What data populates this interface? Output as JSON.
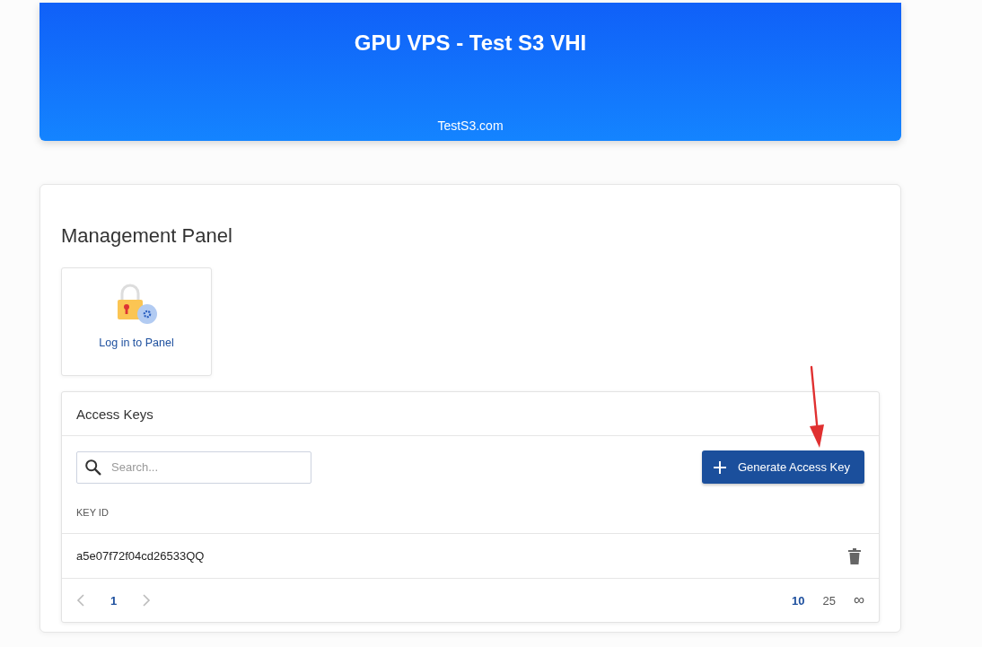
{
  "header": {
    "title": "GPU VPS - Test S3 VHI",
    "domain": "TestS3.com"
  },
  "management": {
    "title": "Management Panel",
    "tiles": [
      {
        "label": "Log in to Panel"
      }
    ]
  },
  "access_keys": {
    "title": "Access Keys",
    "search": {
      "placeholder": "Search..."
    },
    "generate_button": "Generate Access Key",
    "columns": [
      "KEY ID"
    ],
    "rows": [
      {
        "key_id": "a5e07f72f04cd26533QQ"
      }
    ],
    "pages": [
      {
        "label": "1",
        "selected": true
      }
    ],
    "page_sizes": [
      {
        "label": "10",
        "selected": true
      },
      {
        "label": "25",
        "selected": false
      },
      {
        "label": "∞",
        "selected": false
      }
    ]
  }
}
